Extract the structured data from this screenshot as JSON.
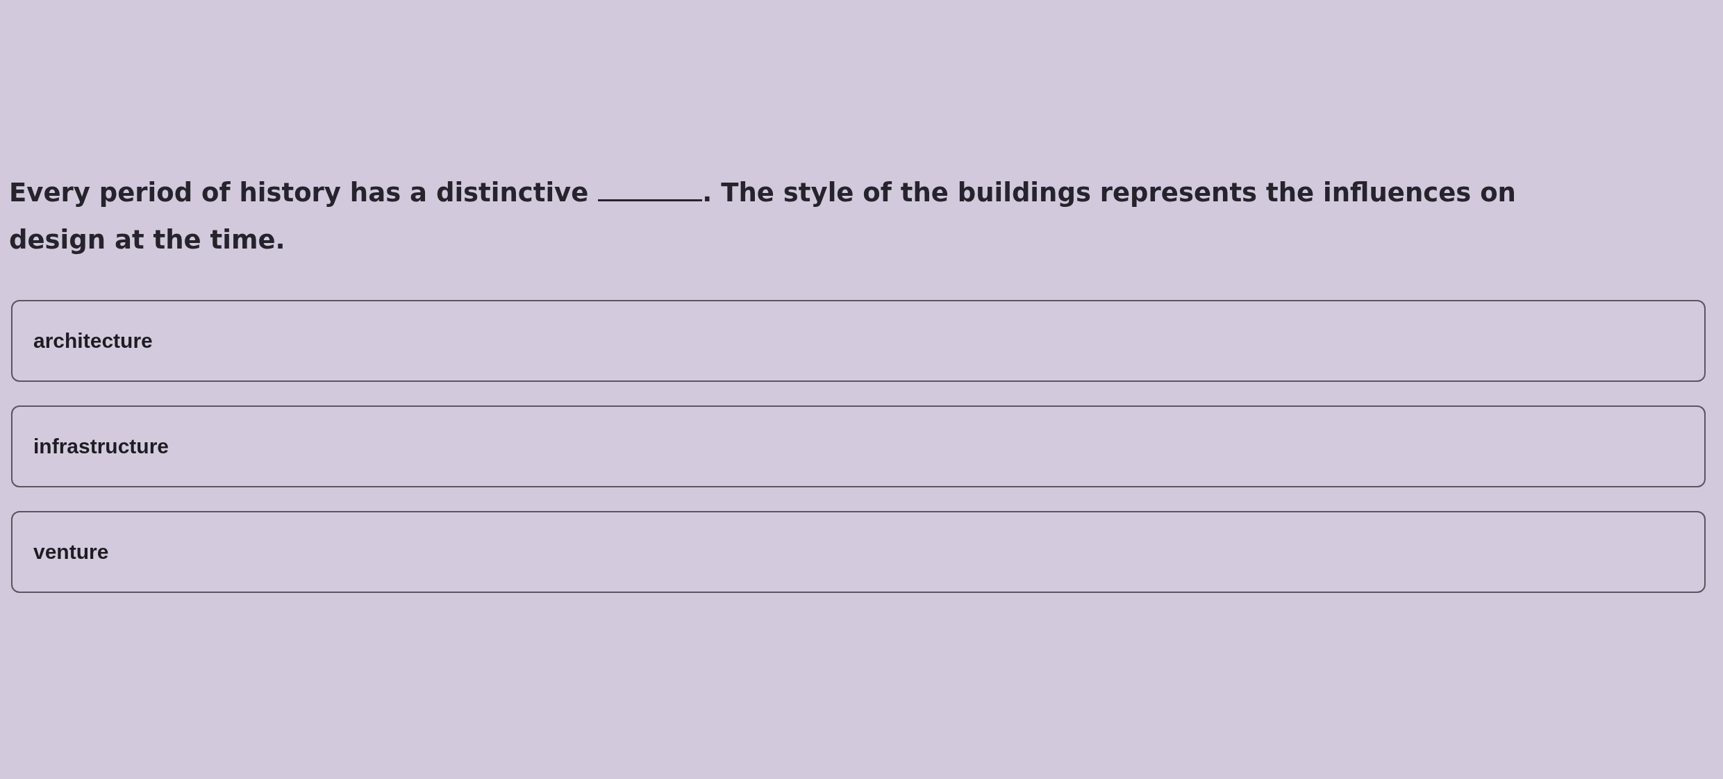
{
  "question": {
    "text_before_blank": "Every period of history has a distinctive",
    "text_after_blank": ". The style of the buildings represents the influences on design at the time."
  },
  "options": [
    {
      "label": "architecture",
      "selected": false
    },
    {
      "label": "infrastructure",
      "selected": false
    },
    {
      "label": "venture",
      "selected": false
    }
  ]
}
